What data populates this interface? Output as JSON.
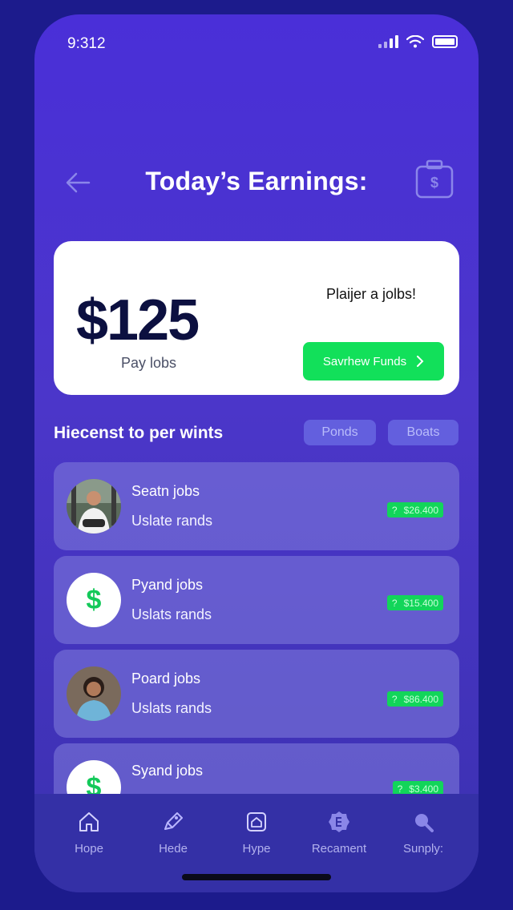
{
  "status_bar": {
    "time": "9:312"
  },
  "header": {
    "title": "Today’s Earnings:"
  },
  "earnings_card": {
    "amount": "$125",
    "subtitle": "Pay lobs",
    "prompt": "Plaijer a jolbs!",
    "button_label": "Savrhew Funds",
    "button_color": "#12e05a"
  },
  "section": {
    "title": "Hiecenst to per wints",
    "chips": [
      "Ponds",
      "Boats"
    ]
  },
  "jobs": [
    {
      "name": "Seatn jobs",
      "subtitle": "Uslate rands",
      "amount": "$26.400",
      "badge_icon": "?",
      "avatar": "photo-man"
    },
    {
      "name": "Pyand jobs",
      "subtitle": "Uslats rands",
      "amount": "$15.400",
      "badge_icon": "?",
      "avatar": "dollar-icon"
    },
    {
      "name": "Poard jobs",
      "subtitle": "Uslats rands",
      "amount": "$86.400",
      "badge_icon": "?",
      "avatar": "photo-woman"
    },
    {
      "name": "Syand jobs",
      "subtitle": "",
      "amount": "$3.400",
      "badge_icon": "?",
      "avatar": "dollar-icon"
    }
  ],
  "bottom_nav": [
    {
      "label": "Hope",
      "icon": "home-icon"
    },
    {
      "label": "Hede",
      "icon": "tag-icon"
    },
    {
      "label": "Hype",
      "icon": "house-box-icon"
    },
    {
      "label": "Recament",
      "icon": "badge-icon"
    },
    {
      "label": "Sunply:",
      "icon": "search-icon"
    }
  ],
  "colors": {
    "background": "#1c1b8c",
    "screen": "#4a2fd8",
    "accent_green": "#12e05a",
    "card": "#ffffff"
  }
}
